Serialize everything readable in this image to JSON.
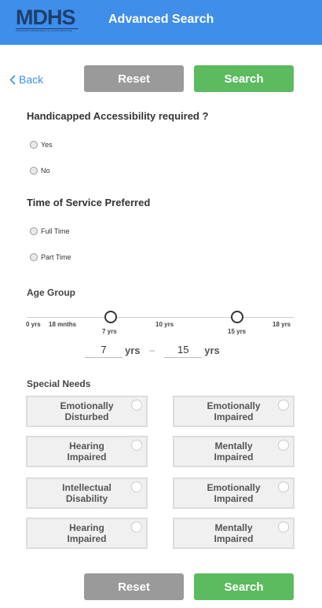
{
  "header": {
    "logo": "MDHS",
    "logo_sub": "MISSISSIPPI DEPARTMENT OF HUMAN SERVICES",
    "title": "Advanced Search"
  },
  "nav": {
    "back_label": "Back"
  },
  "buttons": {
    "reset": "Reset",
    "search": "Search"
  },
  "accessibility": {
    "question": "Handicapped Accessibility required ?",
    "options": [
      "Yes",
      "No"
    ]
  },
  "service_time": {
    "question": "Time of Service Preferred",
    "options": [
      "Full Time",
      "Part Time"
    ]
  },
  "age_group": {
    "title": "Age Group",
    "ticks": [
      "0 yrs",
      "18 mnths",
      "7 yrs",
      "10 yrs",
      "15 yrs",
      "18 yrs"
    ],
    "min_value": "7",
    "max_value": "15",
    "unit": "yrs",
    "separator": "–"
  },
  "special_needs": {
    "title": "Special Needs",
    "items": [
      "Emotionally\nDisturbed",
      "Emotionally\nImpaired",
      "Hearing\nImpaired",
      "Mentally\nImpaired",
      "Intellectual\nDisability",
      "Emotionally\nImpaired",
      "Hearing\nImpaired",
      "Mentally\nImpaired"
    ]
  }
}
